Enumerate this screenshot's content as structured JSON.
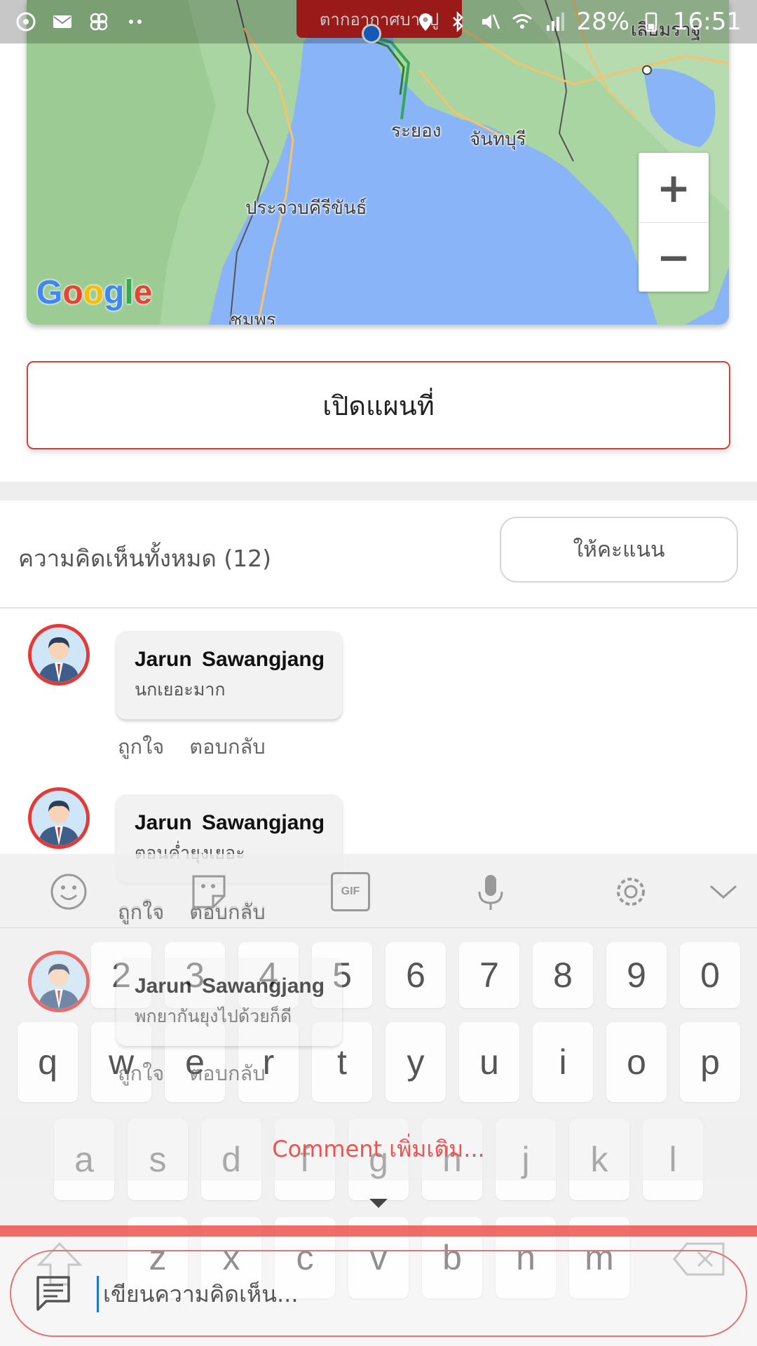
{
  "status_bar": {
    "left_icons": [
      "rotate-lock-icon",
      "mail-icon",
      "pinwheel-icon",
      "more-dots-icon"
    ],
    "battery": "28%",
    "time": "16:51"
  },
  "map": {
    "place_tag": "ตากอากาศบางปู",
    "labels": {
      "rayong": "ระยอง",
      "chanthaburi": "จันทบุรี",
      "prachuap": "ประจวบคีรีขันธ์",
      "chumphon": "ชุมพร",
      "siem_reap": "เสียมราฐ"
    },
    "logo": [
      "G",
      "o",
      "o",
      "g",
      "l",
      "e"
    ],
    "zoom_in": "+",
    "zoom_out": "−",
    "colors": {
      "sea": "#8ab4f8",
      "land": "#a8d5a2",
      "route": "#34a853",
      "marker": "#1a73e8"
    }
  },
  "open_map_button": "เปิดแผนที่",
  "comments_header": {
    "title": "ความคิดเห็นทั้งหมด (12)",
    "rate_button": "ให้คะแนน"
  },
  "comments": [
    {
      "name": "Jarun  Sawangjang",
      "text": "นกเยอะมาก",
      "like": "ถูกใจ",
      "reply": "ตอบกลับ"
    },
    {
      "name": "Jarun  Sawangjang",
      "text": "ตอนค่ำยุงเยอะ",
      "like": "ถูกใจ",
      "reply": "ตอบกลับ"
    },
    {
      "name": "Jarun  Sawangjang",
      "text": "พกยากันยุงไปด้วยก็ดี",
      "like": "ถูกใจ",
      "reply": "ตอบกลับ"
    }
  ],
  "keyboard": {
    "toolbar_icons": [
      "emoji-icon",
      "sticker-icon",
      "gif-icon",
      "microphone-icon",
      "settings-icon",
      "collapse-icon"
    ],
    "gif_label": "GIF",
    "number_row": [
      "2",
      "3",
      "4",
      "5",
      "6",
      "7",
      "8",
      "9",
      "0"
    ],
    "row1": [
      "q",
      "w",
      "e",
      "r",
      "t",
      "y",
      "u",
      "i",
      "o",
      "p"
    ],
    "row2": [
      "a",
      "s",
      "d",
      "f",
      "g",
      "h",
      "j",
      "k",
      "l"
    ],
    "row3": [
      "z",
      "x",
      "c",
      "v",
      "b",
      "n",
      "m"
    ]
  },
  "more_comments": "Comment เพิ่มเติม...",
  "comment_input": {
    "placeholder": "เขียนความคิดเห็น..."
  },
  "accent_color": "#e53935"
}
